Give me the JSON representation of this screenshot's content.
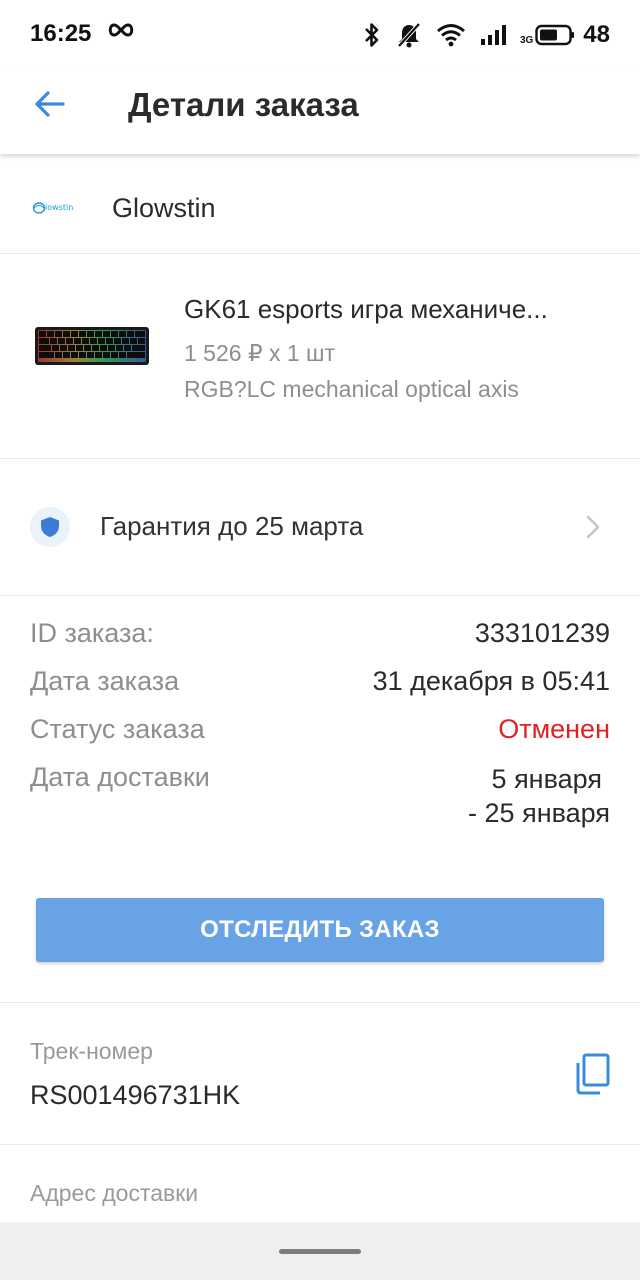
{
  "status_bar": {
    "time": "16:25",
    "network_label": "3G",
    "battery": "48",
    "icons": [
      "infinity-icon",
      "bluetooth-icon",
      "bell-muted-icon",
      "wifi-icon",
      "signal-icon",
      "battery-icon"
    ]
  },
  "header": {
    "title": "Детали заказа",
    "back_icon": "arrow-left-icon"
  },
  "seller": {
    "logo_text": "glowstin",
    "name": "Glowstin"
  },
  "product": {
    "title": "GK61 esports игра механиче...",
    "price_qty": "1 526 ₽ x 1 шт",
    "variant": "RGB?LC mechanical optical axis"
  },
  "warranty": {
    "text": "Гарантия до 25 марта",
    "icon": "shield-icon"
  },
  "details": {
    "order_id_label": "ID заказа:",
    "order_id": "333101239",
    "order_date_label": "Дата заказа",
    "order_date": "31 декабря в 05:41",
    "status_label": "Статус заказа",
    "status": "Отменен",
    "delivery_label": "Дата доставки",
    "delivery_line1": "5 января",
    "delivery_line2": "- 25 января"
  },
  "track_button": {
    "label": "ОТСЛЕДИТЬ ЗАКАЗ"
  },
  "tracking": {
    "label": "Трек-номер",
    "number": "RS001496731HK"
  },
  "address": {
    "label": "Адрес доставки"
  },
  "colors": {
    "accent": "#68a3e6",
    "back_arrow": "#3b8bdb",
    "status_cancelled": "#e62021",
    "shield": "#3d7bd6"
  }
}
